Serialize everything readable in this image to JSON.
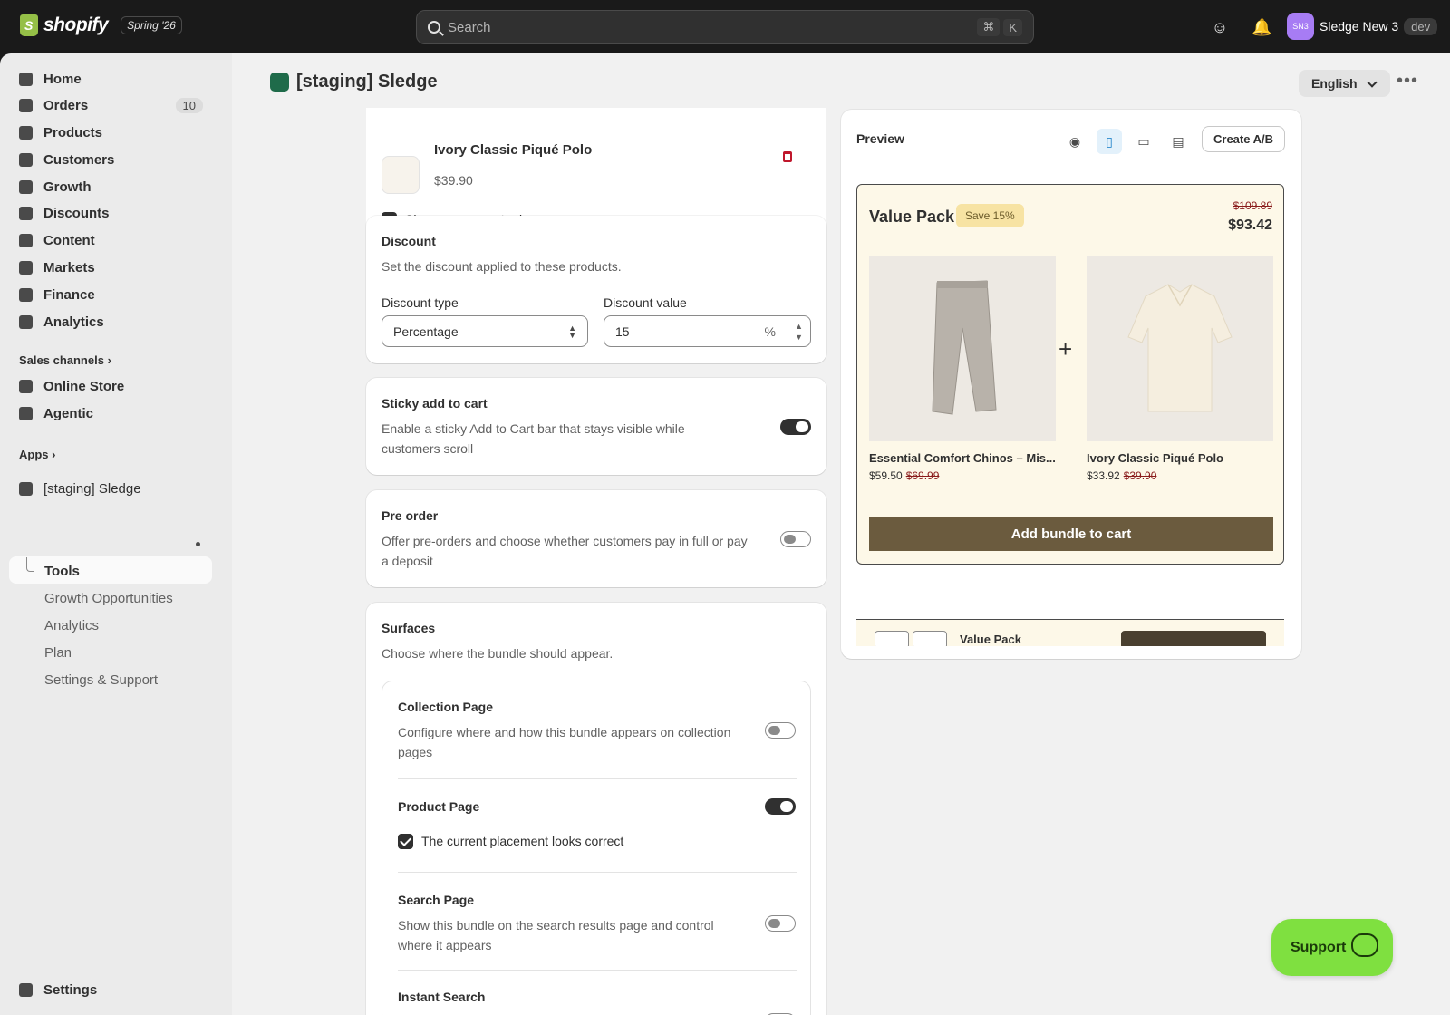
{
  "topbar": {
    "brand": "shopify",
    "release_badge": "Spring '26",
    "search_placeholder": "Search",
    "shortcut_cmd": "⌘",
    "shortcut_key": "K",
    "avatar_initials": "SN3",
    "account_name": "Sledge New 3",
    "account_badge": "dev"
  },
  "sidebar": {
    "items": [
      {
        "label": "Home",
        "icon": "home-icon"
      },
      {
        "label": "Orders",
        "icon": "orders-icon",
        "count": "10"
      },
      {
        "label": "Products",
        "icon": "tag-icon"
      },
      {
        "label": "Customers",
        "icon": "person-icon"
      },
      {
        "label": "Growth",
        "icon": "growth-icon"
      },
      {
        "label": "Discounts",
        "icon": "discount-icon"
      },
      {
        "label": "Content",
        "icon": "content-icon"
      },
      {
        "label": "Markets",
        "icon": "globe-icon"
      },
      {
        "label": "Finance",
        "icon": "bank-icon"
      },
      {
        "label": "Analytics",
        "icon": "chart-icon"
      }
    ],
    "sales_channels_label": "Sales channels",
    "channels": [
      {
        "label": "Online Store",
        "icon": "store-icon"
      },
      {
        "label": "Agentic",
        "icon": "agentic-icon"
      }
    ],
    "apps_label": "Apps",
    "app_name": "[staging] Sledge",
    "app_sub": [
      "Tools",
      "Growth Opportunities",
      "Analytics",
      "Plan",
      "Settings & Support"
    ],
    "settings_label": "Settings"
  },
  "header": {
    "title": "[staging] Sledge",
    "language": "English"
  },
  "product_card": {
    "product_name": "Ivory Classic Piqué Polo",
    "price": "$39.90",
    "compare_label": "Show compare-at price"
  },
  "discount": {
    "title": "Discount",
    "desc": "Set the discount applied to these products.",
    "type_label": "Discount type",
    "type_value": "Percentage",
    "value_label": "Discount value",
    "value": "15",
    "suffix": "%"
  },
  "sticky": {
    "title": "Sticky add to cart",
    "desc": "Enable a sticky Add to Cart bar that stays visible while customers scroll",
    "enabled": true
  },
  "preorder": {
    "title": "Pre order",
    "desc": "Offer pre-orders and choose whether customers pay in full or pay a deposit",
    "enabled": false
  },
  "surfaces": {
    "title": "Surfaces",
    "desc": "Choose where the bundle should appear.",
    "collection_title": "Collection Page",
    "collection_desc": "Configure where and how this bundle appears on collection pages",
    "product_title": "Product Page",
    "product_check": "The current placement looks correct",
    "search_title": "Search Page",
    "search_desc": "Show this bundle on the search results page and control where it appears",
    "instant_title": "Instant Search"
  },
  "preview": {
    "title": "Preview",
    "ab_button": "Create A/B",
    "bundle_title": "Value Pack",
    "save_badge": "Save 15%",
    "old_total": "$109.89",
    "new_total": "$93.42",
    "products": [
      {
        "name": "Essential Comfort Chinos – Mis...",
        "price": "$59.50",
        "old_price": "$69.99"
      },
      {
        "name": "Ivory Classic Piqué Polo",
        "price": "$33.92",
        "old_price": "$39.90"
      }
    ],
    "add_button": "Add bundle to cart",
    "sticky_bundle_title": "Value Pack"
  },
  "support": {
    "label": "Support"
  },
  "colors": {
    "accent_green": "#7fe040",
    "bundle_bg": "#fdf8e8",
    "add_button": "#6b5b3e",
    "strike_red": "#8a1c1c"
  }
}
